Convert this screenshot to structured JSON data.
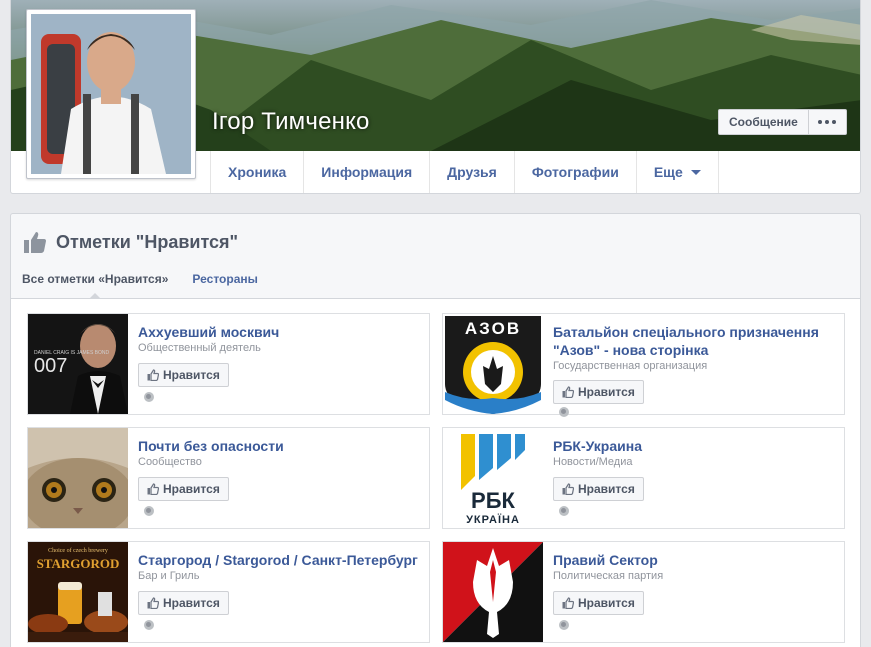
{
  "profile": {
    "name": "Ігор Тимченко",
    "message_button": "Сообщение"
  },
  "nav": {
    "tabs": [
      {
        "label": "Хроника"
      },
      {
        "label": "Информация"
      },
      {
        "label": "Друзья"
      },
      {
        "label": "Фотографии"
      },
      {
        "label": "Еще"
      }
    ]
  },
  "likes": {
    "title": "Отметки \"Нравится\"",
    "subtabs": [
      "Все отметки «Нравится»",
      "Рестораны"
    ],
    "like_label": "Нравится",
    "items": [
      {
        "name": "Аххуевший москвич",
        "category": "Общественный деятель"
      },
      {
        "name": "Батальйон спеціального призначення \"Азов\" - нова сторінка",
        "category": "Государственная организация"
      },
      {
        "name": "Почти без опасности",
        "category": "Сообщество"
      },
      {
        "name": "РБК-Украина",
        "category": "Новости/Медиа"
      },
      {
        "name": "Старгород / Stargorod / Санкт-Петербург",
        "category": "Бар и Гриль"
      },
      {
        "name": "Правий Сектор",
        "category": "Политическая партия"
      }
    ],
    "thumb_text": {
      "bond_small": "DANIEL CRAIG IS JAMES BOND",
      "bond_007": "007",
      "azov_top": "АЗОВ",
      "rbk_main": "РБК",
      "rbk_sub": "УКРАЇНА",
      "stargorod_top": "Choice of czech brewery",
      "stargorod_main": "STARGOROD"
    }
  },
  "colors": {
    "link_blue": "#3b5998",
    "nav_blue": "#4b67a1",
    "page_bg": "#e9eaed",
    "border": "#d3d6db"
  }
}
